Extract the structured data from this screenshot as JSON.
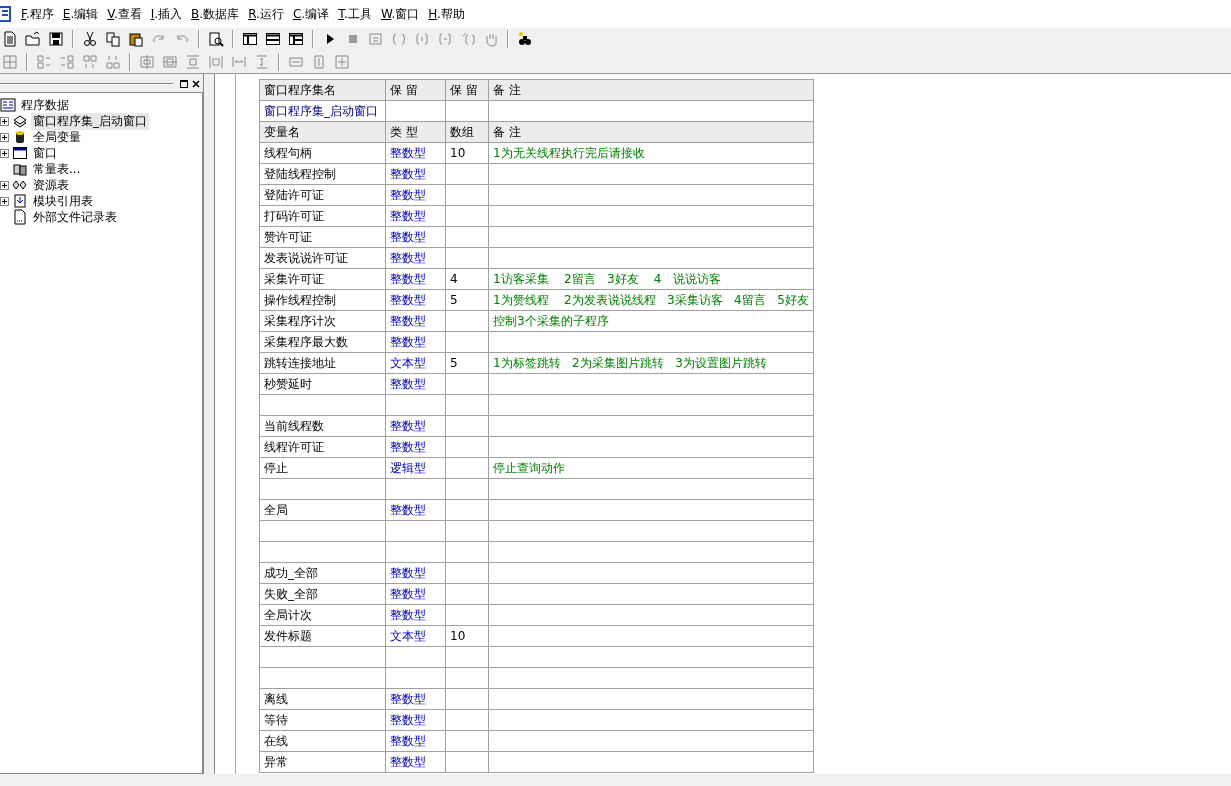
{
  "menu": [
    {
      "label": "F.程序"
    },
    {
      "label": "E.编辑"
    },
    {
      "label": "V.查看"
    },
    {
      "label": "I.插入"
    },
    {
      "label": "B.数据库"
    },
    {
      "label": "R.运行"
    },
    {
      "label": "C.编译"
    },
    {
      "label": "T.工具"
    },
    {
      "label": "W.窗口"
    },
    {
      "label": "H.帮助"
    }
  ],
  "tree": {
    "label": "程序数据",
    "children": [
      {
        "label": "窗口程序集_启动窗口",
        "kind": "module",
        "expanded": false,
        "selected": true
      },
      {
        "label": "全局变量",
        "kind": "globals",
        "expanded": false,
        "selected": false
      },
      {
        "label": "窗口",
        "kind": "window",
        "expanded": false,
        "selected": false
      },
      {
        "label": "常量表...",
        "kind": "constants",
        "selected": false
      },
      {
        "label": "资源表",
        "kind": "resources",
        "expanded": false,
        "selected": false
      },
      {
        "label": "模块引用表",
        "kind": "modules",
        "expanded": false,
        "selected": false
      },
      {
        "label": "外部文件记录表",
        "kind": "files",
        "selected": false
      }
    ]
  },
  "module_table": {
    "columns": [
      "窗口程序集名",
      "保 留",
      "保 留",
      "备 注"
    ],
    "rows": [
      {
        "name": "窗口程序集_启动窗口"
      }
    ]
  },
  "variables": {
    "columns": [
      "变量名",
      "类 型",
      "数组",
      "备 注"
    ],
    "rows": [
      {
        "name": "线程句柄",
        "type": "整数型",
        "array": "10",
        "note": "1为无关线程执行完后请接收"
      },
      {
        "name": "登陆线程控制",
        "type": "整数型"
      },
      {
        "name": "登陆许可证",
        "type": "整数型"
      },
      {
        "name": "打码许可证",
        "type": "整数型"
      },
      {
        "name": "赞许可证",
        "type": "整数型"
      },
      {
        "name": "发表说说许可证",
        "type": "整数型"
      },
      {
        "name": "采集许可证",
        "type": "整数型",
        "array": "4",
        "note": "1访客采集    2留言   3好友    4   说说访客"
      },
      {
        "name": "操作线程控制",
        "type": "整数型",
        "array": "5",
        "note": "1为赞线程    2为发表说说线程   3采集访客   4留言   5好友"
      },
      {
        "name": "采集程序计次",
        "type": "整数型",
        "note": "控制3个采集的子程序"
      },
      {
        "name": "采集程序最大数",
        "type": "整数型"
      },
      {
        "name": "跳转连接地址",
        "type": "文本型",
        "array": "5",
        "note": "1为标签跳转   2为采集图片跳转   3为设置图片跳转"
      },
      {
        "name": "秒赞延时",
        "type": "整数型"
      },
      {},
      {
        "name": "当前线程数",
        "type": "整数型"
      },
      {
        "name": "线程许可证",
        "type": "整数型"
      },
      {
        "name": "停止",
        "type": "逻辑型",
        "note": "停止查询动作"
      },
      {},
      {
        "name": "全局",
        "type": "整数型"
      },
      {},
      {},
      {
        "name": "成功_全部",
        "type": "整数型"
      },
      {
        "name": "失败_全部",
        "type": "整数型"
      },
      {
        "name": "全局计次",
        "type": "整数型"
      },
      {
        "name": "发件标题",
        "type": "文本型",
        "array": "10"
      },
      {},
      {},
      {
        "name": "离线",
        "type": "整数型"
      },
      {
        "name": "等待",
        "type": "整数型"
      },
      {
        "name": "在线",
        "type": "整数型"
      },
      {
        "name": "异常",
        "type": "整数型"
      }
    ]
  }
}
